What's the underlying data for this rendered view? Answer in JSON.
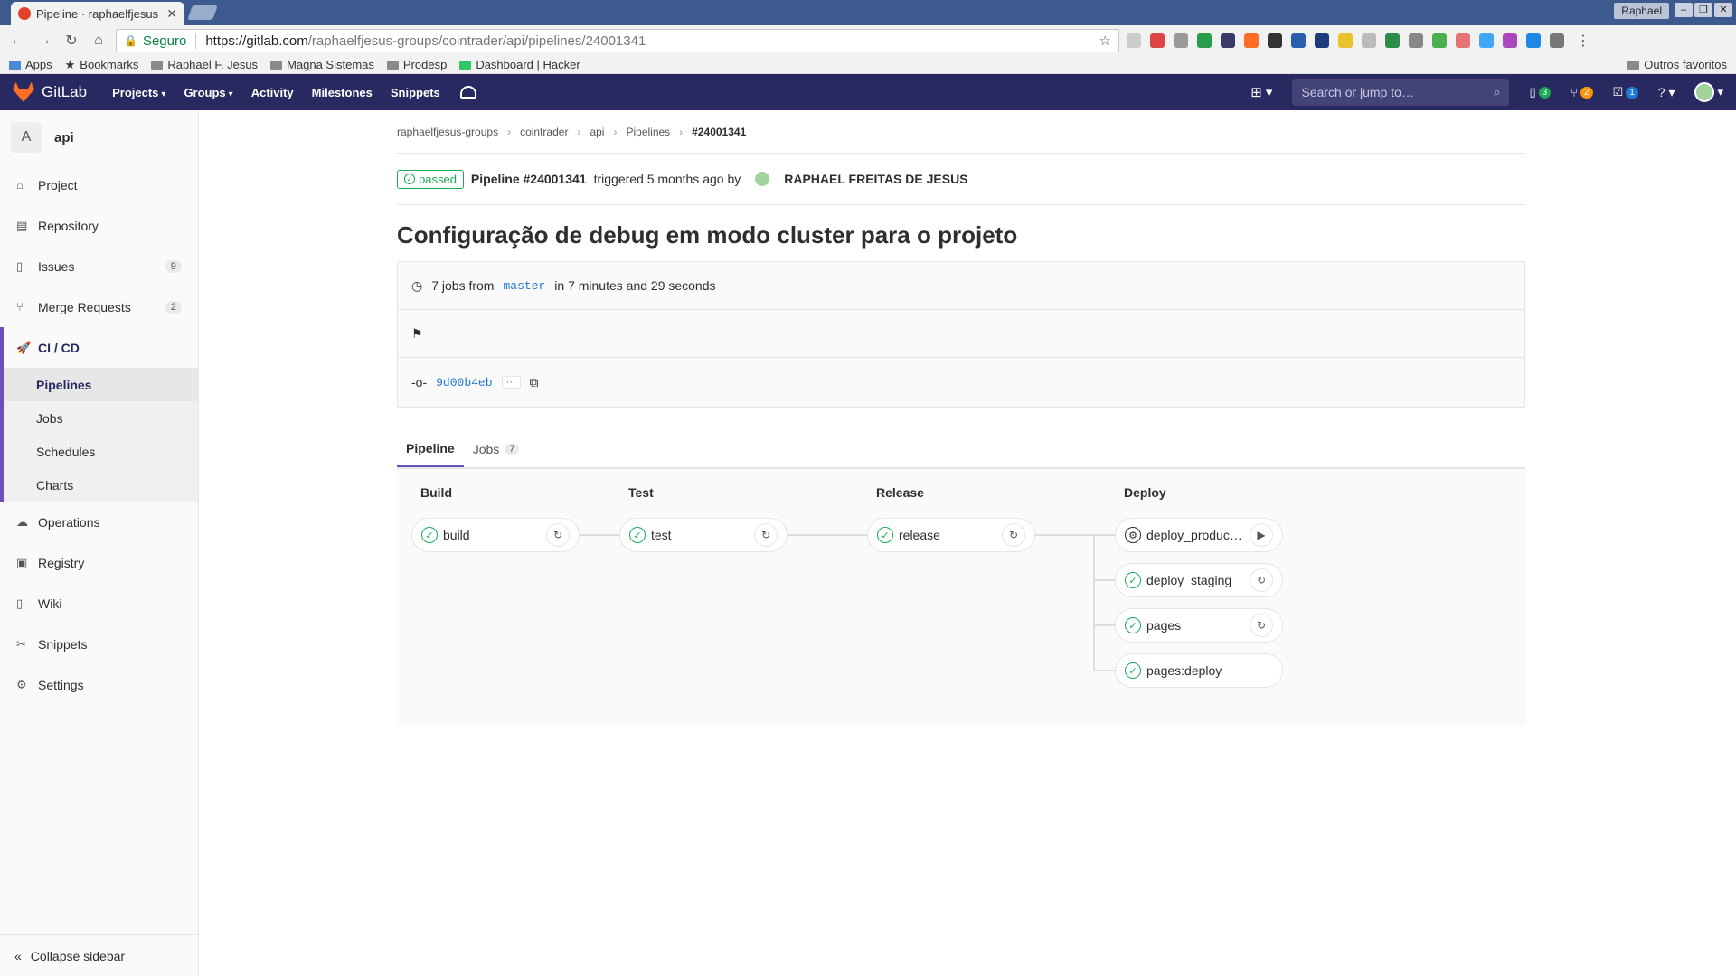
{
  "browser": {
    "tab_title": "Pipeline · raphaelfjesus",
    "secure_label": "Seguro",
    "url_host": "https://gitlab.com",
    "url_path": "/raphaelfjesus-groups/cointrader/api/pipelines/24001341",
    "user": "Raphael",
    "bookmarks": [
      "Apps",
      "Bookmarks",
      "Raphael F. Jesus",
      "Magna Sistemas",
      "Prodesp",
      "Dashboard | Hacker"
    ],
    "bookmarks_right": "Outros favoritos"
  },
  "gitlab_nav": {
    "brand": "GitLab",
    "menu": [
      "Projects",
      "Groups",
      "Activity",
      "Milestones",
      "Snippets"
    ],
    "search_placeholder": "Search or jump to…",
    "counts": [
      "3",
      "2",
      "1"
    ]
  },
  "sidebar": {
    "project_initial": "A",
    "project_name": "api",
    "items": [
      {
        "label": "Project",
        "badge": ""
      },
      {
        "label": "Repository",
        "badge": ""
      },
      {
        "label": "Issues",
        "badge": "9"
      },
      {
        "label": "Merge Requests",
        "badge": "2"
      },
      {
        "label": "CI / CD",
        "badge": ""
      },
      {
        "label": "Operations",
        "badge": ""
      },
      {
        "label": "Registry",
        "badge": ""
      },
      {
        "label": "Wiki",
        "badge": ""
      },
      {
        "label": "Snippets",
        "badge": ""
      },
      {
        "label": "Settings",
        "badge": ""
      }
    ],
    "cicd_sub": [
      "Pipelines",
      "Jobs",
      "Schedules",
      "Charts"
    ],
    "collapse": "Collapse sidebar"
  },
  "breadcrumb": [
    "raphaelfjesus-groups",
    "cointrader",
    "api",
    "Pipelines",
    "#24001341"
  ],
  "pipeline": {
    "status": "passed",
    "id_label": "Pipeline #24001341",
    "triggered": "triggered 5 months ago by",
    "author": "RAPHAEL FREITAS DE JESUS",
    "title": "Configuração de debug em modo cluster para o projeto",
    "jobs_text_pre": "7 jobs from",
    "branch": "master",
    "jobs_text_post": "in 7 minutes and 29 seconds",
    "commit": "9d00b4eb",
    "ellipsis": "···"
  },
  "tabs": [
    {
      "label": "Pipeline",
      "count": ""
    },
    {
      "label": "Jobs",
      "count": "7"
    }
  ],
  "stages": [
    {
      "title": "Build",
      "jobs": [
        {
          "name": "build",
          "status": "success",
          "action": "retry"
        }
      ]
    },
    {
      "title": "Test",
      "jobs": [
        {
          "name": "test",
          "status": "success",
          "action": "retry"
        }
      ]
    },
    {
      "title": "Release",
      "jobs": [
        {
          "name": "release",
          "status": "success",
          "action": "retry"
        }
      ]
    },
    {
      "title": "Deploy",
      "jobs": [
        {
          "name": "deploy_producti...",
          "status": "manual",
          "action": "play"
        },
        {
          "name": "deploy_staging",
          "status": "success",
          "action": "retry"
        },
        {
          "name": "pages",
          "status": "success",
          "action": "retry"
        },
        {
          "name": "pages:deploy",
          "status": "success",
          "action": ""
        }
      ]
    }
  ],
  "colors": {
    "nav": "#292961",
    "success": "#1aaa55",
    "accent": "#6b4fbb",
    "link": "#1f78d1"
  }
}
